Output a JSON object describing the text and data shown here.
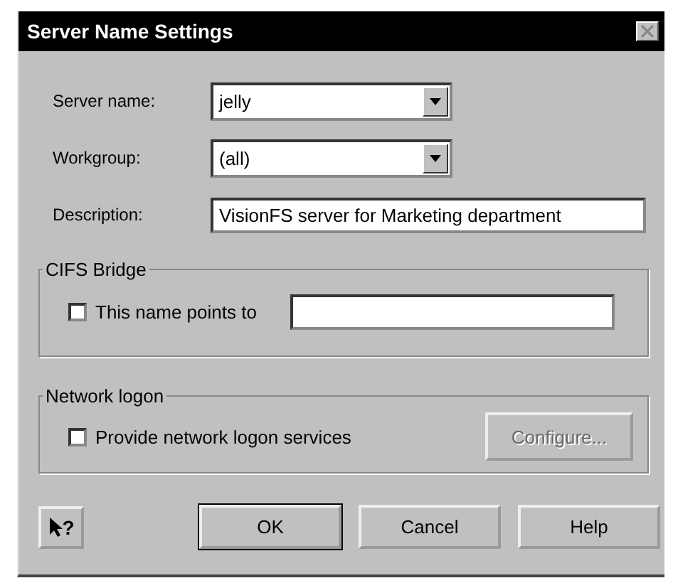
{
  "window": {
    "title": "Server Name Settings",
    "close_disabled": true
  },
  "fields": [
    {
      "kind": "dropdown",
      "label": "Server name:",
      "value": "jelly"
    },
    {
      "kind": "dropdown",
      "label": "Workgroup:",
      "value": "(all)"
    },
    {
      "kind": "text",
      "label": "Description:",
      "value": "VisionFS server for Marketing department"
    }
  ],
  "cifs_bridge": {
    "title": "CIFS Bridge",
    "checkbox": {
      "label": "This name points to",
      "checked": false
    }
  },
  "network_logon": {
    "title": "Network logon",
    "checkbox": {
      "label": "Provide network logon services",
      "checked": false
    },
    "button": {
      "label": "Configure...",
      "disabled": true
    }
  },
  "context_help": {
    "label": "?"
  },
  "buttons": [
    {
      "label": "OK",
      "default": true
    },
    {
      "label": "Cancel",
      "default": false
    },
    {
      "label": "Help",
      "default": false
    }
  ]
}
